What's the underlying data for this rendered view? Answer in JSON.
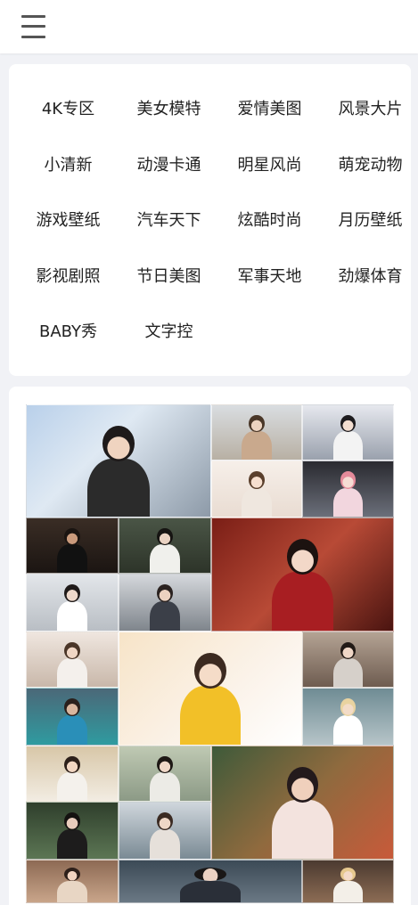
{
  "header": {
    "menu_icon": "hamburger-menu-icon"
  },
  "categories": [
    "4K专区",
    "美女模特",
    "爱情美图",
    "风景大片",
    "小清新",
    "动漫卡通",
    "明星风尚",
    "萌宠动物",
    "游戏壁纸",
    "汽车天下",
    "炫酷时尚",
    "月历壁纸",
    "影视剧照",
    "节日美图",
    "军事天地",
    "劲爆体育",
    "BABY秀",
    "文字控"
  ],
  "gallery": {
    "photos": [
      {
        "bg": "linear-gradient(135deg,#b9d0ea 0%,#dfe9f3 40%,#8d9aa8 100%)",
        "hair": "#1e1a1a",
        "skin": "#f0d4c0",
        "cloth": "#2b2b2b"
      },
      {
        "bg": "linear-gradient(180deg,#d9dde1 0%,#b8b0a4 100%)",
        "hair": "#4a3728",
        "skin": "#ecd3c0",
        "cloth": "#c9a98d"
      },
      {
        "bg": "linear-gradient(180deg,#e6e8ee 0%,#9aa1ad 100%)",
        "hair": "#1d1b1e",
        "skin": "#f2ddd0",
        "cloth": "#f3f3f3"
      },
      {
        "bg": "linear-gradient(180deg,#f6efe9 0%,#e9dcd2 100%)",
        "hair": "#5a3f2c",
        "skin": "#f6dfcf",
        "cloth": "#efe7df"
      },
      {
        "bg": "linear-gradient(180deg,#2a2a30 0%,#6b6f7a 100%)",
        "hair": "#e58a9a",
        "skin": "#f6dcd4",
        "cloth": "#f2d6de"
      },
      {
        "bg": "linear-gradient(180deg,#3a2d25 0%,#1b1512 100%)",
        "hair": "#1a1411",
        "skin": "#c99a7c",
        "cloth": "#111111"
      },
      {
        "bg": "linear-gradient(180deg,#4a5546 0%,#2d3429 100%)",
        "hair": "#161412",
        "skin": "#e9d2c2",
        "cloth": "#f0f0ec"
      },
      {
        "bg": "linear-gradient(135deg,#7a1e16 0%,#b84a36 50%,#4a1410 100%)",
        "hair": "#1c1210",
        "skin": "#f3d8c8",
        "cloth": "#a81e22"
      },
      {
        "bg": "linear-gradient(180deg,#e3e6ea 0%,#b9bec4 100%)",
        "hair": "#1f1a19",
        "skin": "#eed8ca",
        "cloth": "#ffffff"
      },
      {
        "bg": "linear-gradient(180deg,#d5d8dc 0%,#7f858c 100%)",
        "hair": "#2a2220",
        "skin": "#ecd2c0",
        "cloth": "#3b3f48"
      },
      {
        "bg": "linear-gradient(180deg,#efe6df 0%,#c9b8aa 100%)",
        "hair": "#4b3628",
        "skin": "#f0d6c4",
        "cloth": "#f4f0ec"
      },
      {
        "bg": "linear-gradient(135deg,#f7e4c8 0%,#fbf3ea 60%,#ffffff 100%)",
        "hair": "#3c2a20",
        "skin": "#f5dcc8",
        "cloth": "#f2c028"
      },
      {
        "bg": "linear-gradient(180deg,#b4a394 0%,#6e5c50 100%)",
        "hair": "#221a16",
        "skin": "#efd6c6",
        "cloth": "#d6d0ca"
      },
      {
        "bg": "linear-gradient(180deg,#4b6878 0%,#2f9ba0 100%)",
        "hair": "#2a201c",
        "skin": "#d9b69e",
        "cloth": "#2a8fb8"
      },
      {
        "bg": "linear-gradient(180deg,#6f8c94 0%,#b6c4c8 100%)",
        "hair": "#e9d3a0",
        "skin": "#f3dcc8",
        "cloth": "#ffffff"
      },
      {
        "bg": "linear-gradient(180deg,#d8c7a8 0%,#f2ece2 100%)",
        "hair": "#2d201a",
        "skin": "#f1d6c2",
        "cloth": "#f4f1ec"
      },
      {
        "bg": "linear-gradient(180deg,#bfc9b3 0%,#8c9a86 100%)",
        "hair": "#1e1815",
        "skin": "#f0d8c8",
        "cloth": "#ecebe6"
      },
      {
        "bg": "linear-gradient(135deg,#3e5a3a 0%,#8f6a3e 50%,#c85a3a 100%)",
        "hair": "#241a1c",
        "skin": "#f0d0bc",
        "cloth": "#f3e3de"
      },
      {
        "bg": "linear-gradient(180deg,#2f3f2c 0%,#5c7654 100%)",
        "hair": "#141210",
        "skin": "#e8ccbc",
        "cloth": "#1d1c1c"
      },
      {
        "bg": "linear-gradient(180deg,#cfd6dc 0%,#7a8a94 100%)",
        "hair": "#3a2a22",
        "skin": "#efd7c6",
        "cloth": "#e6e0da"
      },
      {
        "bg": "linear-gradient(180deg,#8d6a54 0%,#c9a58a 100%)",
        "hair": "#2e201a",
        "skin": "#f2d4c0",
        "cloth": "#e8d6c4"
      },
      {
        "bg": "linear-gradient(180deg,#3b4a56 0%,#6a7884 100%)",
        "hair": "#1a1716",
        "skin": "#ecd2c2",
        "cloth": "#2a2f38"
      },
      {
        "bg": "linear-gradient(180deg,#4b3a30 0%,#8c6c54 100%)",
        "hair": "#e6c88e",
        "skin": "#f4dac8",
        "cloth": "#f3efe8"
      }
    ]
  }
}
